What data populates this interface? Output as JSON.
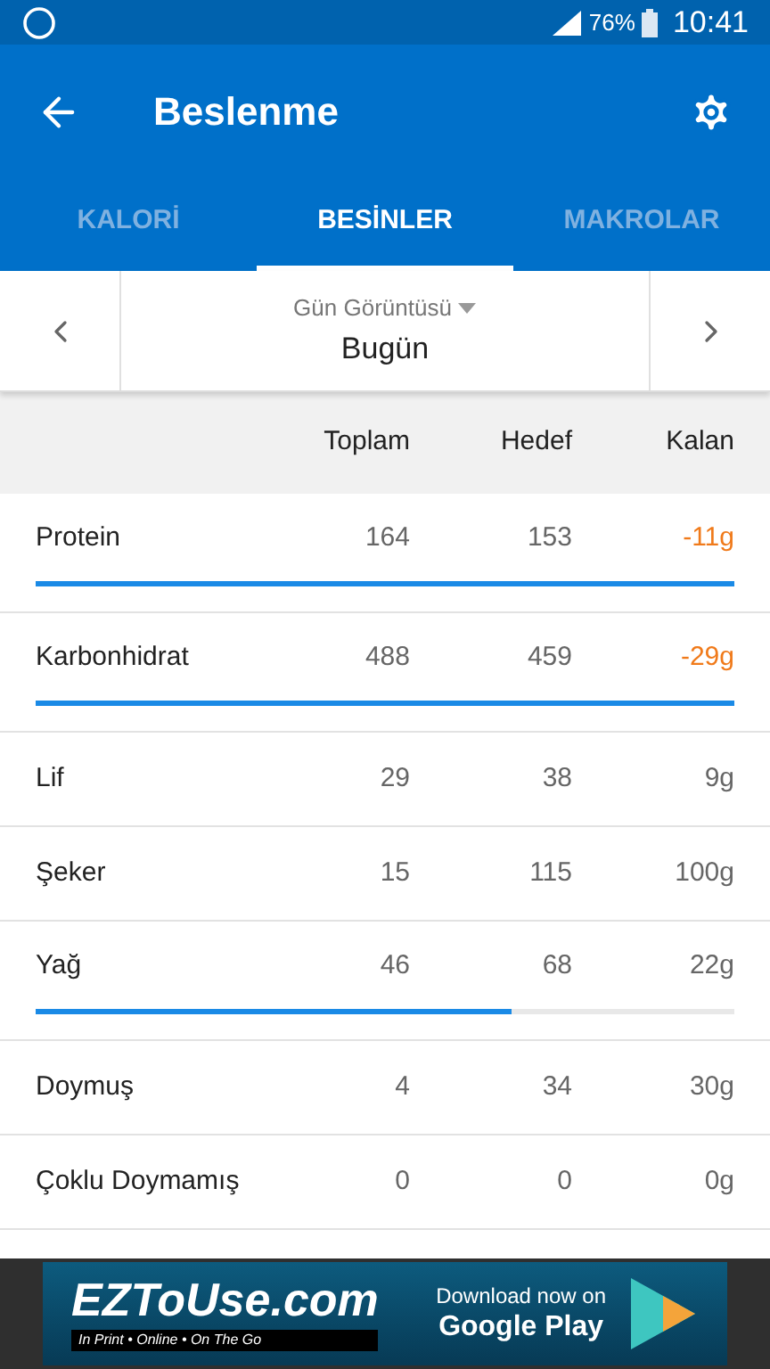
{
  "status_bar": {
    "battery": "76%",
    "time": "10:41"
  },
  "toolbar": {
    "title": "Beslenme"
  },
  "tabs": [
    {
      "label": "KALORİ",
      "selected": false
    },
    {
      "label": "BESİNLER",
      "selected": true
    },
    {
      "label": "MAKROLAR",
      "selected": false
    }
  ],
  "date_selector": {
    "label": "Gün Görüntüsü",
    "value": "Bugün"
  },
  "table": {
    "columns": [
      "Toplam",
      "Hedef",
      "Kalan"
    ],
    "rows": [
      {
        "name": "Protein",
        "total": "164",
        "goal": "153",
        "remaining": "-11g",
        "over": true,
        "level": 1
      },
      {
        "name": "Karbonhidrat",
        "total": "488",
        "goal": "459",
        "remaining": "-29g",
        "over": true,
        "level": 1
      },
      {
        "name": "Lif",
        "total": "29",
        "goal": "38",
        "remaining": "9g",
        "over": false
      },
      {
        "name": "Şeker",
        "total": "15",
        "goal": "115",
        "remaining": "100g",
        "over": false
      },
      {
        "name": "Yağ",
        "total": "46",
        "goal": "68",
        "remaining": "22g",
        "over": false,
        "level": 0.68
      },
      {
        "name": "Doymuş",
        "total": "4",
        "goal": "34",
        "remaining": "30g",
        "over": false
      },
      {
        "name": "Çoklu Doymamış",
        "total": "0",
        "goal": "0",
        "remaining": "0g",
        "over": false
      }
    ]
  },
  "ad": {
    "brand": "EZToUse.com",
    "tagline": "In Print • Online • On The Go",
    "cta_line1": "Download now on",
    "cta_line2": "Google Play"
  }
}
